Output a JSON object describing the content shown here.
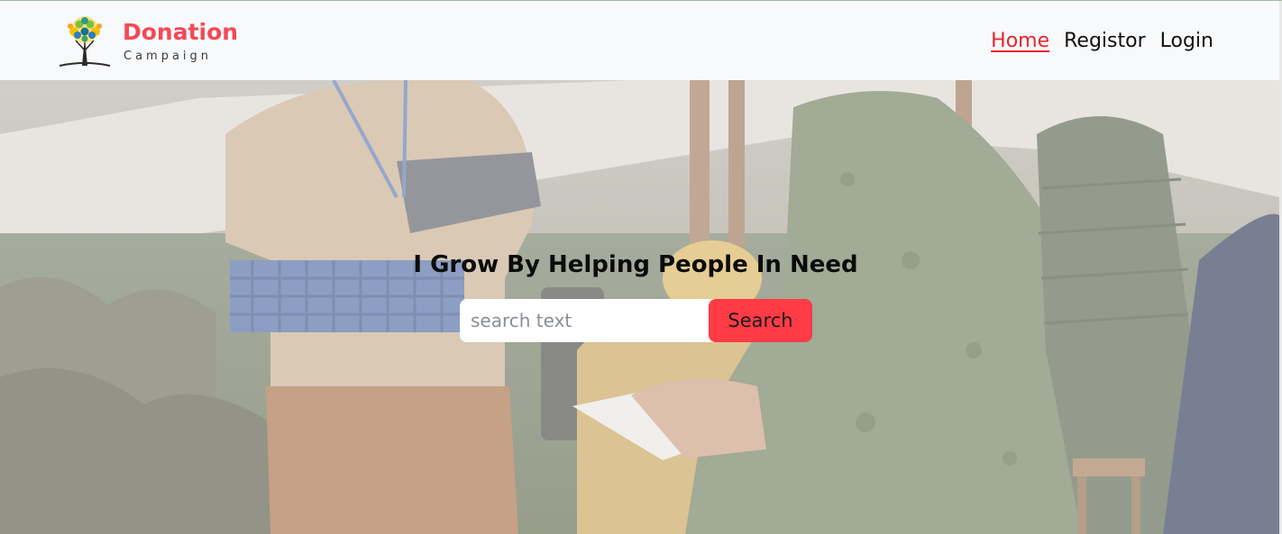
{
  "brand": {
    "title": "Donation",
    "subtitle": "Campaign"
  },
  "nav": {
    "items": [
      {
        "label": "Home",
        "active": true
      },
      {
        "label": "Registor",
        "active": false
      },
      {
        "label": "Login",
        "active": false
      }
    ]
  },
  "hero": {
    "heading": "I Grow By Helping People In Need",
    "search": {
      "placeholder": "search text",
      "value": "",
      "button_label": "Search"
    }
  },
  "colors": {
    "brand_red": "#f24a55",
    "active_link": "#e8242e",
    "search_button": "#ff3b46",
    "navbar_bg": "#f8f9fb"
  },
  "icons": {
    "logo": "tree-logo-icon"
  }
}
